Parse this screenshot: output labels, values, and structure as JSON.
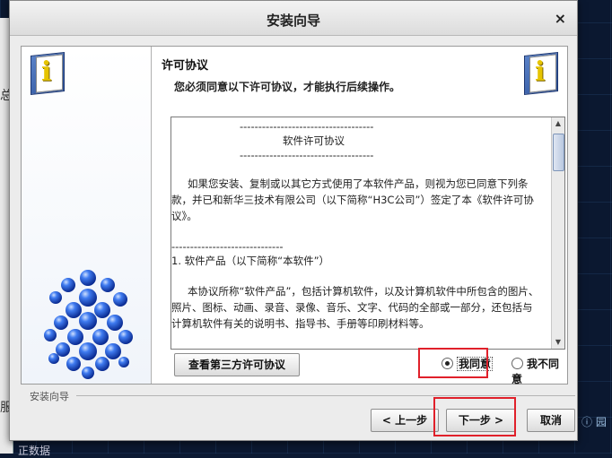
{
  "dialog": {
    "title": "安装向导",
    "close_glyph": "×"
  },
  "header": {
    "title": "许可协议",
    "subtitle": "您必须同意以下许可协议，才能执行后续操作。"
  },
  "license": {
    "lines": [
      "------------------------------------",
      "软件许可协议",
      "------------------------------------",
      "如果您安装、复制或以其它方式使用了本软件产品，则视为您已同意下列条",
      "款，并已和新华三技术有限公司（以下简称“H3C公司”）签定了本《软件许可协",
      "议》。",
      "------------------------------",
      "1. 软件产品（以下简称“本软件”）",
      "本协议所称“软件产品”，包括计算机软件，以及计算机软件中所包含的图片、",
      "照片、图标、动画、录音、录像、音乐、文字、代码的全部或一部分，还包括与",
      "计算机软件有关的说明书、指导书、手册等印刷材料等。"
    ]
  },
  "buttons": {
    "third_party": "查看第三方许可协议",
    "prev": "< 上一步",
    "next": "下一步 >",
    "cancel": "取消"
  },
  "options": {
    "agree": "我同意",
    "disagree": "我不同意",
    "selected": "agree"
  },
  "footer": {
    "label": "安装向导"
  },
  "background": {
    "left_text_1": "总",
    "left_text_2": "服",
    "bottom_text": "正数据",
    "right_text": "ⓘ 园"
  },
  "icons": {
    "info": "info-book-icon",
    "molecule": "molecule-graphic",
    "radio": "radio-icon"
  },
  "colors": {
    "highlight": "#e0202a",
    "molecule_blue": "#1a4fd0"
  }
}
